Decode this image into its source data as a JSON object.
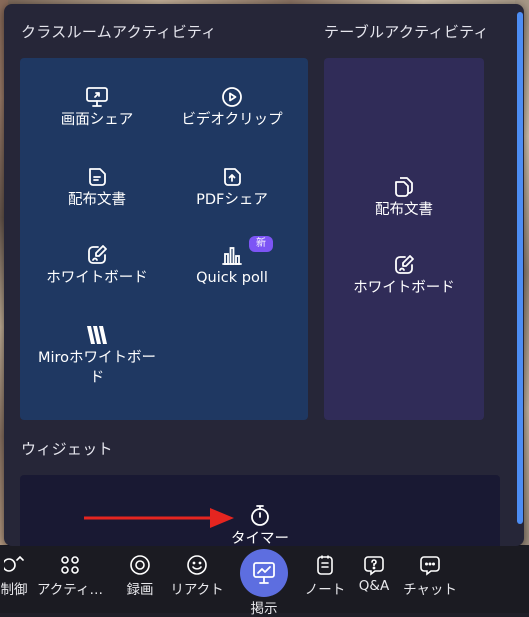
{
  "panel": {
    "classroom_title": "クラスルームアクティビティ",
    "table_title": "テーブルアクティビティ",
    "widget_title": "ウィジェット",
    "classroom_items": [
      {
        "label": "画面シェア",
        "icon": "monitor-share-icon"
      },
      {
        "label": "ビデオクリップ",
        "icon": "play-circle-icon"
      },
      {
        "label": "配布文書",
        "icon": "document-icon"
      },
      {
        "label": "PDFシェア",
        "icon": "pdf-upload-icon"
      },
      {
        "label": "ホワイトボード",
        "icon": "whiteboard-pen-icon"
      },
      {
        "label": "Quick poll",
        "icon": "bar-chart-icon",
        "badge": "新"
      },
      {
        "label": "Miroホワイトボード",
        "icon": "miro-logo-icon"
      }
    ],
    "table_items": [
      {
        "label": "配布文書",
        "icon": "documents-stack-icon"
      },
      {
        "label": "ホワイトボード",
        "icon": "whiteboard-pen-icon"
      }
    ],
    "widget_items": [
      {
        "label": "タイマー",
        "icon": "stopwatch-icon"
      }
    ]
  },
  "toolbar": {
    "items": [
      {
        "label": "制御",
        "icon": "control-icon"
      },
      {
        "label": "アクティ…",
        "icon": "activities-icon"
      },
      {
        "label": "録画",
        "icon": "record-icon"
      },
      {
        "label": "リアクト",
        "icon": "smiley-icon"
      },
      {
        "label": "掲示",
        "icon": "present-icon"
      },
      {
        "label": "ノート",
        "icon": "notes-icon"
      },
      {
        "label": "Q&A",
        "icon": "qa-icon"
      },
      {
        "label": "チャット",
        "icon": "chat-icon"
      }
    ]
  },
  "colors": {
    "panel_bg": "#262638",
    "classroom_card": "#1f3862",
    "table_card": "#302c58",
    "widget_card": "#191933",
    "accent": "#5d6ee0",
    "badge": "#7d55f5",
    "arrow": "#e52520"
  }
}
